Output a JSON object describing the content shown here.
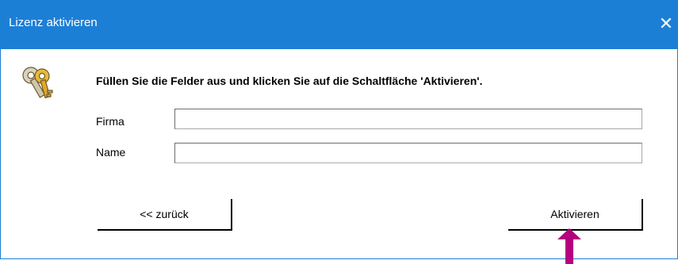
{
  "window": {
    "title": "Lizenz aktivieren",
    "close_glyph": "✕",
    "accent_color": "#1c7fd6"
  },
  "content": {
    "icon": "keys-icon",
    "instruction": "Füllen Sie die Felder aus und klicken Sie auf die Schaltfläche 'Aktivieren'.",
    "fields": [
      {
        "label": "Firma",
        "value": "",
        "placeholder": ""
      },
      {
        "label": "Name",
        "value": "",
        "placeholder": ""
      }
    ]
  },
  "buttons": {
    "back_label": "<< zurück",
    "activate_label": "Aktivieren"
  },
  "annotation": {
    "icon": "arrow-up-icon",
    "color": "#b5007f"
  }
}
